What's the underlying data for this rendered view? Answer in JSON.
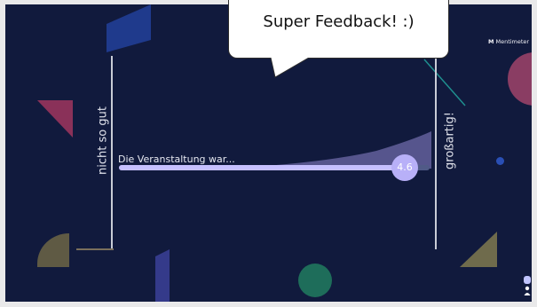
{
  "slide": {
    "question": "Die Veranstaltung war...",
    "scale_left_label": "nicht so gut",
    "scale_right_label": "großartig!",
    "average_value": "4.6",
    "average_fraction": 0.92,
    "brand_label": "Mentimeter",
    "brand_mark": "M"
  },
  "bubble": {
    "text": "Super Feedback! :)"
  },
  "colors": {
    "background": "#111a3d",
    "accent": "#b8b0f8",
    "track": "#505a87"
  },
  "icons": {
    "presenter": "presenter-icon"
  }
}
